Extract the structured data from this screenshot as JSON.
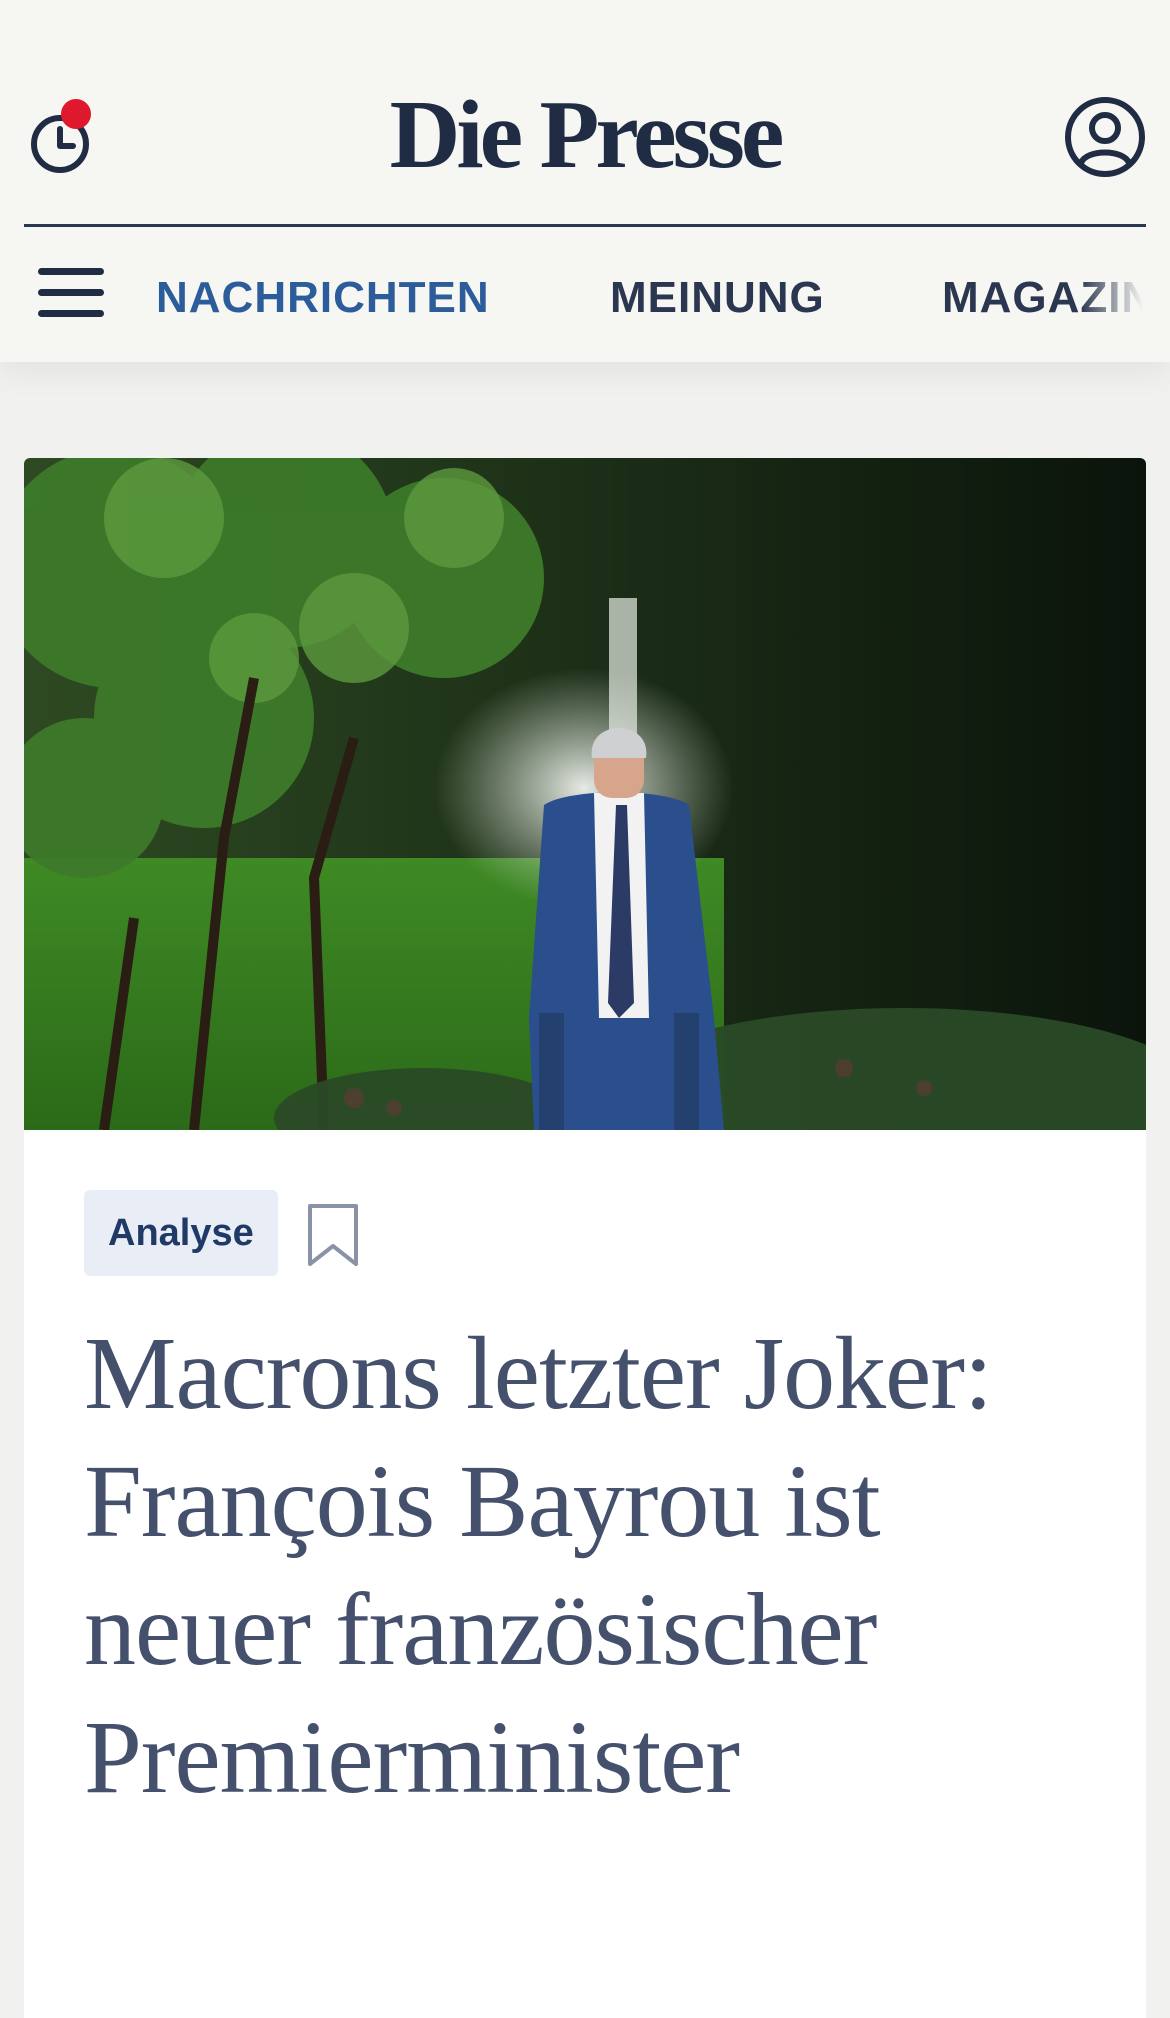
{
  "header": {
    "logo": "Die Presse",
    "history_icon": "clock-icon",
    "notification_dot_color": "#e0182d",
    "user_icon": "user-icon",
    "menu_icon": "hamburger-menu-icon"
  },
  "nav": {
    "items": [
      {
        "label": "NACHRICHTEN",
        "active": true
      },
      {
        "label": "MEINUNG",
        "active": false
      },
      {
        "label": "MAGAZIN",
        "active": false
      }
    ]
  },
  "article": {
    "image_description": "Man in a navy suit walking through a garden with trees and a fountain",
    "tag": "Analyse",
    "bookmark_icon": "bookmark-icon",
    "headline": "Macrons letzter Joker: François Bayrou ist neuer französischer Premierminister"
  },
  "colors": {
    "brand_navy": "#1f2c44",
    "nav_active": "#2c5d9a",
    "headline": "#45516c",
    "tag_bg": "#e9edf5",
    "background": "#f6f6f3"
  }
}
